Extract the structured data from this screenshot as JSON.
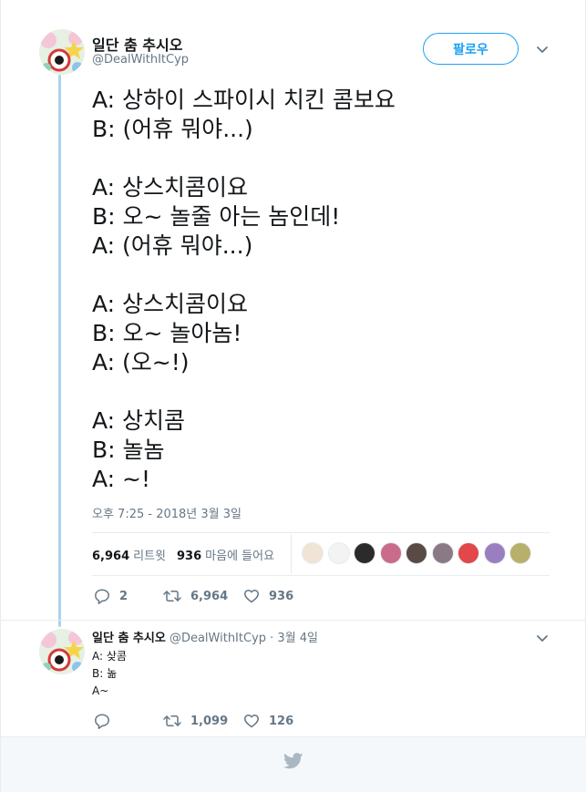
{
  "colors": {
    "accent": "#1da1f2",
    "thread_line": "#aad3eb",
    "muted": "#657786",
    "text": "#14171a"
  },
  "main_tweet": {
    "display_name": "일단 춤 추시오",
    "handle": "@DealWithItCyp",
    "follow_label": "팔로우",
    "lines": [
      "A: 상하이 스파이시 치킨 콤보요",
      "B: (어휴 뭐야...)",
      "",
      "A: 상스치콤이요",
      "B: 오~ 놀줄 아는 놈인데!",
      "A: (어휴 뭐야...)",
      "",
      "A: 상스치콤이요",
      "B: 오~ 놀아놈!",
      "A: (오~!)",
      "",
      "A: 상치콤",
      "B: 놀놈",
      "A: ~!"
    ],
    "timestamp": "오후 7:25 - 2018년 3월 3일",
    "retweets_count": "6,964",
    "retweets_label": "리트윗",
    "likes_count": "936",
    "likes_label": "마음에 들어요",
    "liker_avatars": [
      "#f1e4d6",
      "#f3f3f3",
      "#2b2b2b",
      "#c96b8a",
      "#5a4a45",
      "#8a7a86",
      "#e2474a",
      "#9a7fc0",
      "#b7b06a"
    ],
    "actions": {
      "reply_count": "2",
      "retweet_count": "6,964",
      "like_count": "936"
    }
  },
  "reply_tweet": {
    "display_name": "일단 춤 추시오",
    "handle": "@DealWithItCyp",
    "date": "· 3월 4일",
    "lines": [
      "A: 샂콤",
      "B: 놂",
      "A~"
    ],
    "actions": {
      "reply_count": "",
      "retweet_count": "1,099",
      "like_count": "126"
    }
  }
}
